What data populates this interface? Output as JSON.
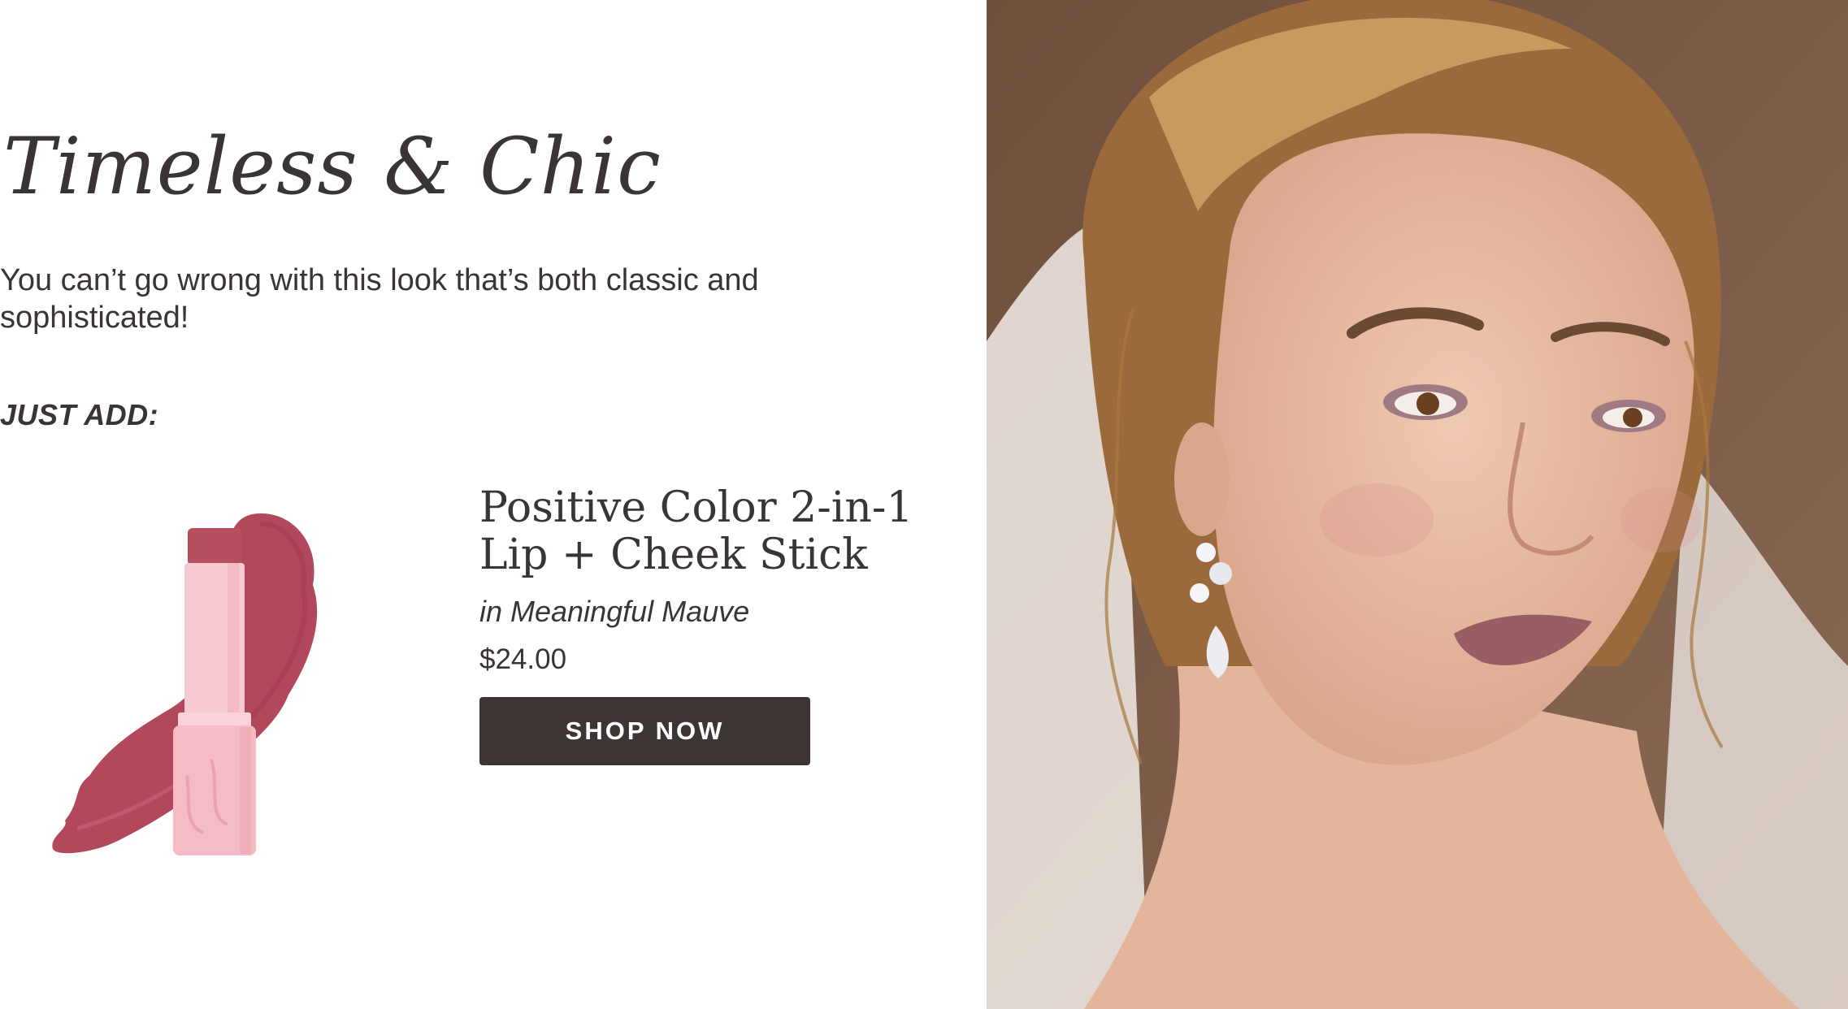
{
  "headline": "Timeless & Chic",
  "intro": "You can’t go wrong with this look that’s both classic and sophisticated!",
  "just_add_label": "JUST ADD:",
  "product": {
    "name": "Positive Color 2-in-1 Lip + Cheek Stick",
    "shade": "in Meaningful Mauve",
    "price": "$24.00",
    "cta": "SHOP NOW",
    "swatch_color": "#b2485c",
    "tube_color": "#f5bfc7"
  },
  "brand": {
    "ink": "#3a3534",
    "button": "#3d3534"
  },
  "hero_image": {
    "description_icon": "portrait-photo",
    "background": "#7a5a45"
  }
}
